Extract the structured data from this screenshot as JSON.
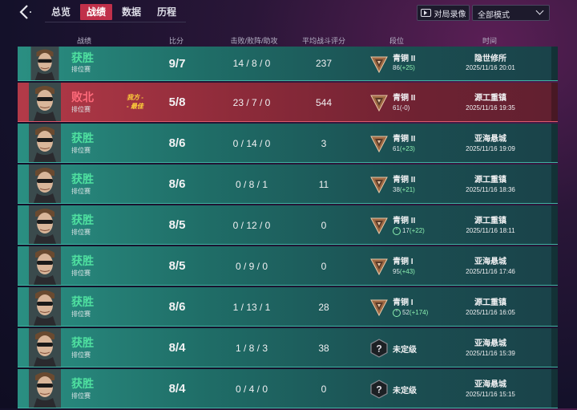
{
  "tabs": [
    "总览",
    "战绩",
    "数据",
    "历程"
  ],
  "active_tab": 1,
  "toolbar": {
    "replay_label": "对局录像",
    "mode_value": "全部模式"
  },
  "headers": {
    "record": "战绩",
    "score": "比分",
    "kda": "击败/败阵/助攻",
    "rating": "平均战斗评分",
    "rank": "段位",
    "time": "时间"
  },
  "mvp_label": [
    "我方 -",
    "- 最佳"
  ],
  "colors": {
    "win": "#4fe0a0",
    "loss": "#ff6a7a",
    "active_tab": "#c0304a",
    "mvp": "#ffd23a"
  },
  "matches": [
    {
      "result": "获胜",
      "mode": "排位赛",
      "score": "9/7",
      "kda": "14 / 8 / 0",
      "rating": "237",
      "rank": "青铜 II",
      "points": "86",
      "delta": "(+25)",
      "map": "隐世修所",
      "time": "2025/11/16 20:01"
    },
    {
      "result": "败北",
      "mode": "排位赛",
      "score": "5/8",
      "kda": "23 / 7 / 0",
      "rating": "544",
      "rank": "青铜 II",
      "points": "61",
      "delta": "(-0)",
      "map": "源工重镇",
      "time": "2025/11/16 19:35"
    },
    {
      "result": "获胜",
      "mode": "排位赛",
      "score": "8/6",
      "kda": "0 / 14 / 0",
      "rating": "3",
      "rank": "青铜 II",
      "points": "61",
      "delta": "(+23)",
      "map": "亚海悬城",
      "time": "2025/11/16 19:09"
    },
    {
      "result": "获胜",
      "mode": "排位赛",
      "score": "8/6",
      "kda": "0 / 8 / 1",
      "rating": "11",
      "rank": "青铜 II",
      "points": "38",
      "delta": "(+21)",
      "map": "源工重镇",
      "time": "2025/11/16 18:36"
    },
    {
      "result": "获胜",
      "mode": "排位赛",
      "score": "8/5",
      "kda": "0 / 12 / 0",
      "rating": "0",
      "rank": "青铜 II",
      "points": "17",
      "delta": "(+22)",
      "map": "源工重镇",
      "time": "2025/11/16 18:11"
    },
    {
      "result": "获胜",
      "mode": "排位赛",
      "score": "8/5",
      "kda": "0 / 9 / 0",
      "rating": "0",
      "rank": "青铜 I",
      "points": "95",
      "delta": "(+43)",
      "map": "亚海悬城",
      "time": "2025/11/16 17:46"
    },
    {
      "result": "获胜",
      "mode": "排位赛",
      "score": "8/6",
      "kda": "1 / 13 / 1",
      "rating": "28",
      "rank": "青铜 I",
      "points": "52",
      "delta": "(+174)",
      "map": "源工重镇",
      "time": "2025/11/16 16:05"
    },
    {
      "result": "获胜",
      "mode": "排位赛",
      "score": "8/4",
      "kda": "1 / 8 / 3",
      "rating": "38",
      "rank": "未定级",
      "points": "",
      "delta": "",
      "map": "亚海悬城",
      "time": "2025/11/16 15:39"
    },
    {
      "result": "获胜",
      "mode": "排位赛",
      "score": "8/4",
      "kda": "0 / 4 / 0",
      "rating": "0",
      "rank": "未定级",
      "points": "",
      "delta": "",
      "map": "亚海悬城",
      "time": "2025/11/16 15:15"
    }
  ]
}
